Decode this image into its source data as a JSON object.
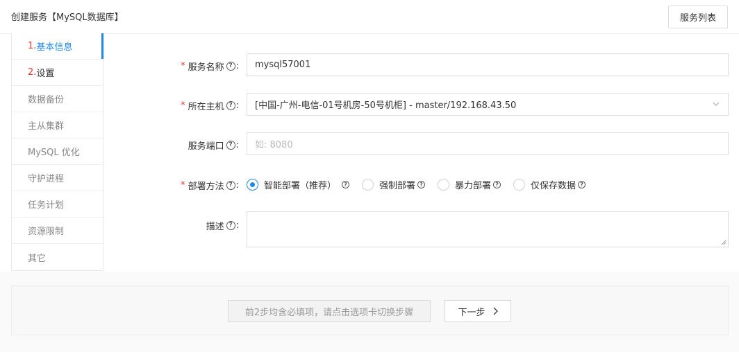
{
  "header": {
    "title": "创建服务【MySQL数据库】",
    "service_list_label": "服务列表"
  },
  "sidebar": {
    "items": [
      {
        "num": "1.",
        "label": "基本信息"
      },
      {
        "num": "2.",
        "label": "设置"
      },
      {
        "label": "数据备份"
      },
      {
        "label": "主从集群"
      },
      {
        "label": "MySQL 优化"
      },
      {
        "label": "守护进程"
      },
      {
        "label": "任务计划"
      },
      {
        "label": "资源限制"
      },
      {
        "label": "其它"
      }
    ]
  },
  "form": {
    "service_name": {
      "label": "服务名称",
      "value": "mysql57001"
    },
    "host": {
      "label": "所在主机",
      "value": "[中国-广州-电信-01号机房-50号机柜] - master/192.168.43.50"
    },
    "port": {
      "label": "服务端口",
      "placeholder": "如: 8080"
    },
    "deploy": {
      "label": "部署方法",
      "options": [
        "智能部署（推荐）",
        "强制部署",
        "暴力部署",
        "仅保存数据"
      ],
      "selected": "智能部署（推荐）"
    },
    "description": {
      "label": "描述"
    }
  },
  "footer": {
    "hint_label": "前2步均含必填项，请点击选项卡切换步骤",
    "next_label": "下一步"
  },
  "colors": {
    "accent": "#1e88e5",
    "required": "#e53935"
  }
}
